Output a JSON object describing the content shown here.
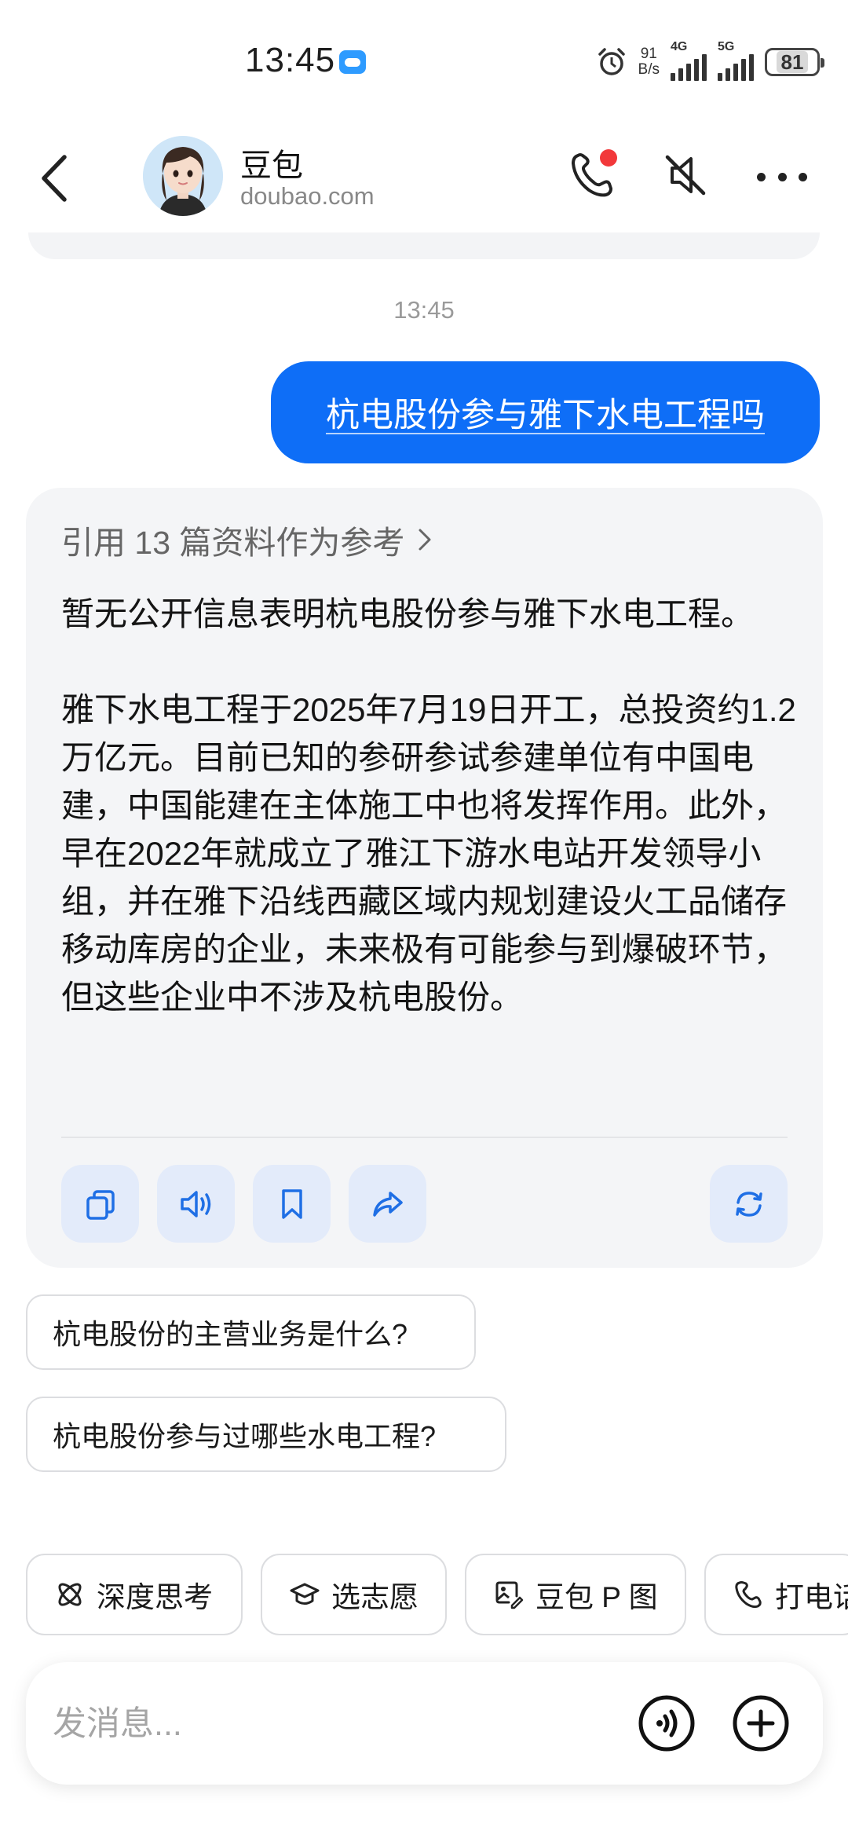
{
  "status_bar": {
    "time": "13:45",
    "net_speed_value": "91",
    "net_speed_unit": "B/s",
    "sim1_label": "4G",
    "sim2_label": "5G",
    "battery": "81"
  },
  "header": {
    "name": "豆包",
    "domain": "doubao.com"
  },
  "chat": {
    "timestamp": "13:45",
    "user_message": "杭电股份参与雅下水电工程吗",
    "references_label": "引用 13 篇资料作为参考",
    "answer_paragraphs": [
      "暂无公开信息表明杭电股份参与雅下水电工程。",
      "雅下水电工程于2025年7月19日开工，总投资约1.2万亿元。目前已知的参研参试参建单位有中国电建，中国能建在主体施工中也将发挥作用。此外，早在2022年就成立了雅江下游水电站开发领导小组，并在雅下沿线西藏区域内规划建设火工品储存移动库房的企业，未来极有可能参与到爆破环节，但这些企业中不涉及杭电股份。"
    ]
  },
  "suggestions": [
    "杭电股份的主营业务是什么?",
    "杭电股份参与过哪些水电工程?"
  ],
  "tools": [
    {
      "label": "深度思考",
      "icon": "atom-icon"
    },
    {
      "label": "选志愿",
      "icon": "graduation-cap-icon"
    },
    {
      "label": "豆包 P 图",
      "icon": "image-edit-icon"
    },
    {
      "label": "打电话",
      "icon": "phone-icon"
    }
  ],
  "input": {
    "placeholder": "发消息..."
  },
  "colors": {
    "accent": "#0e6ef7",
    "card_bg": "#f4f5f7",
    "action_bg": "#e3ebfa",
    "notification_dot": "#f2383a"
  }
}
